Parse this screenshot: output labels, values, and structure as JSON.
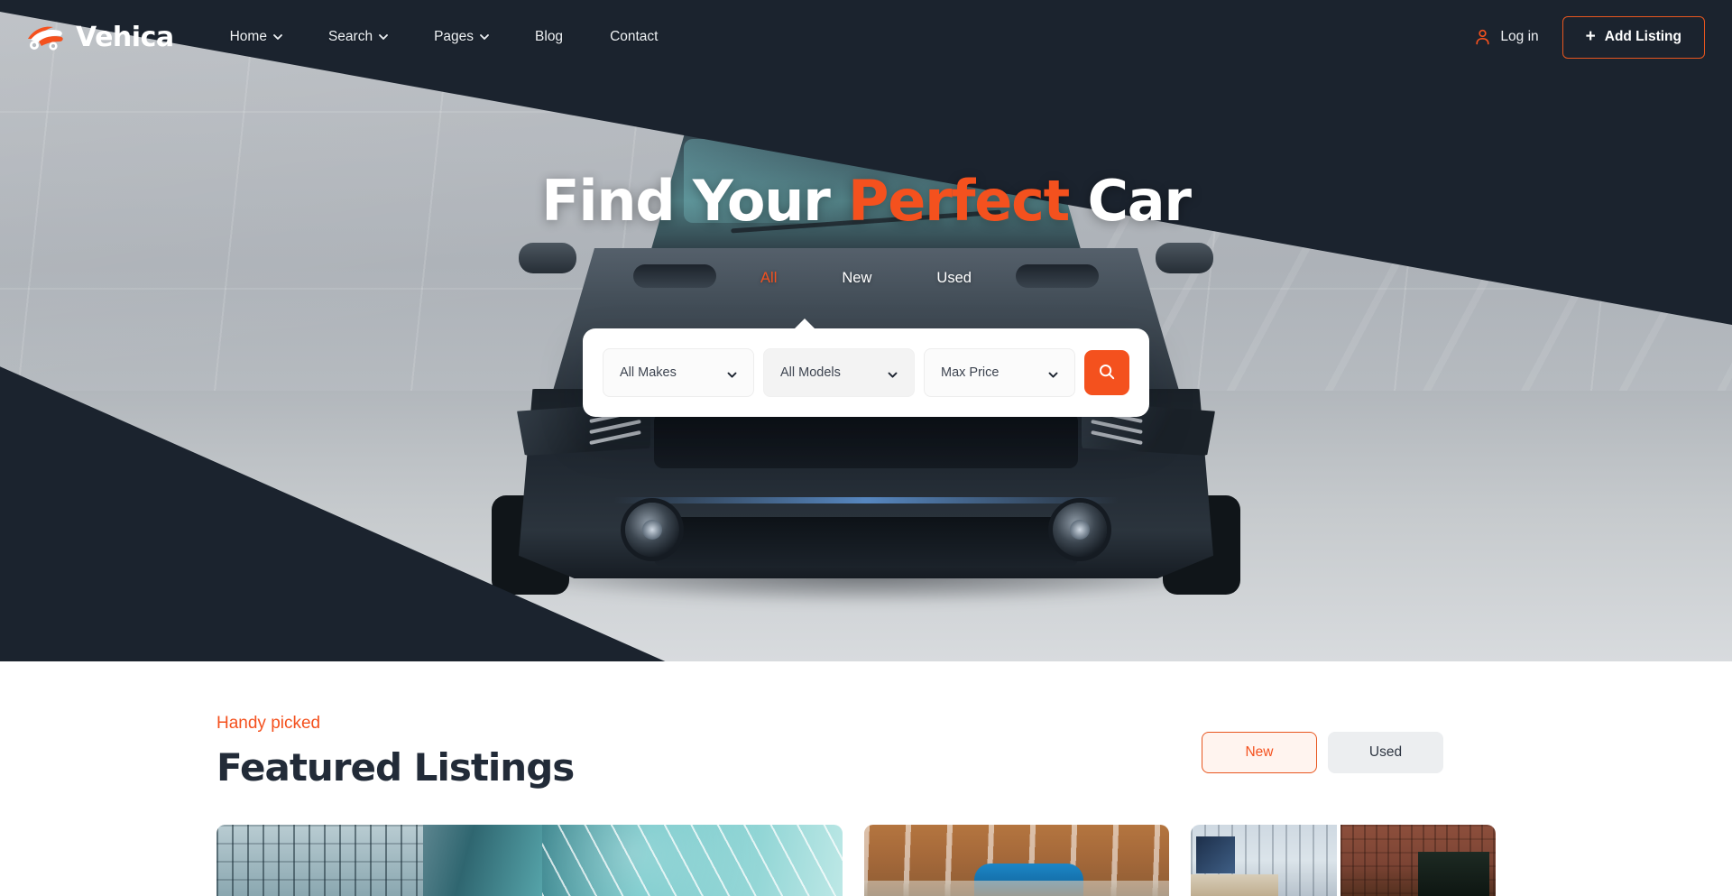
{
  "brand": {
    "name": "Vehica",
    "logo_icon": "car-swoosh-logo-icon",
    "accent_color": "#f4511e",
    "dark_color": "#1b232e"
  },
  "header": {
    "nav": [
      {
        "label": "Home",
        "has_dropdown": true,
        "icon": "chevron-down-icon"
      },
      {
        "label": "Search",
        "has_dropdown": true,
        "icon": "chevron-down-icon"
      },
      {
        "label": "Pages",
        "has_dropdown": true,
        "icon": "chevron-down-icon"
      },
      {
        "label": "Blog",
        "has_dropdown": false,
        "icon": ""
      },
      {
        "label": "Contact",
        "has_dropdown": false,
        "icon": ""
      }
    ],
    "login_label": "Log in",
    "login_icon": "user-icon",
    "add_listing_label": "Add Listing",
    "add_listing_icon": "plus-icon"
  },
  "hero": {
    "title_part1": "Find Your ",
    "title_accent": "Perfect",
    "title_part2": " Car",
    "tabs": [
      {
        "label": "All",
        "active": true
      },
      {
        "label": "New",
        "active": false
      },
      {
        "label": "Used",
        "active": false
      }
    ],
    "search": {
      "make": {
        "value": "All Makes",
        "icon": "chevron-down-icon"
      },
      "model": {
        "value": "All Models",
        "icon": "chevron-down-icon"
      },
      "price": {
        "value": "Max Price",
        "icon": "chevron-down-icon"
      },
      "button_icon": "search-icon"
    }
  },
  "featured": {
    "eyebrow": "Handy picked",
    "title": "Featured Listings",
    "toggle": [
      {
        "label": "New",
        "active": true
      },
      {
        "label": "Used",
        "active": false
      }
    ]
  },
  "cards": [
    {
      "id": "listing-card-1",
      "thumb": "glass-building-water-thumbnail"
    },
    {
      "id": "listing-card-2",
      "thumb": "construction-blue-car-thumbnail"
    },
    {
      "id": "listing-card-3",
      "thumb": "city-street-thumbnail"
    }
  ]
}
